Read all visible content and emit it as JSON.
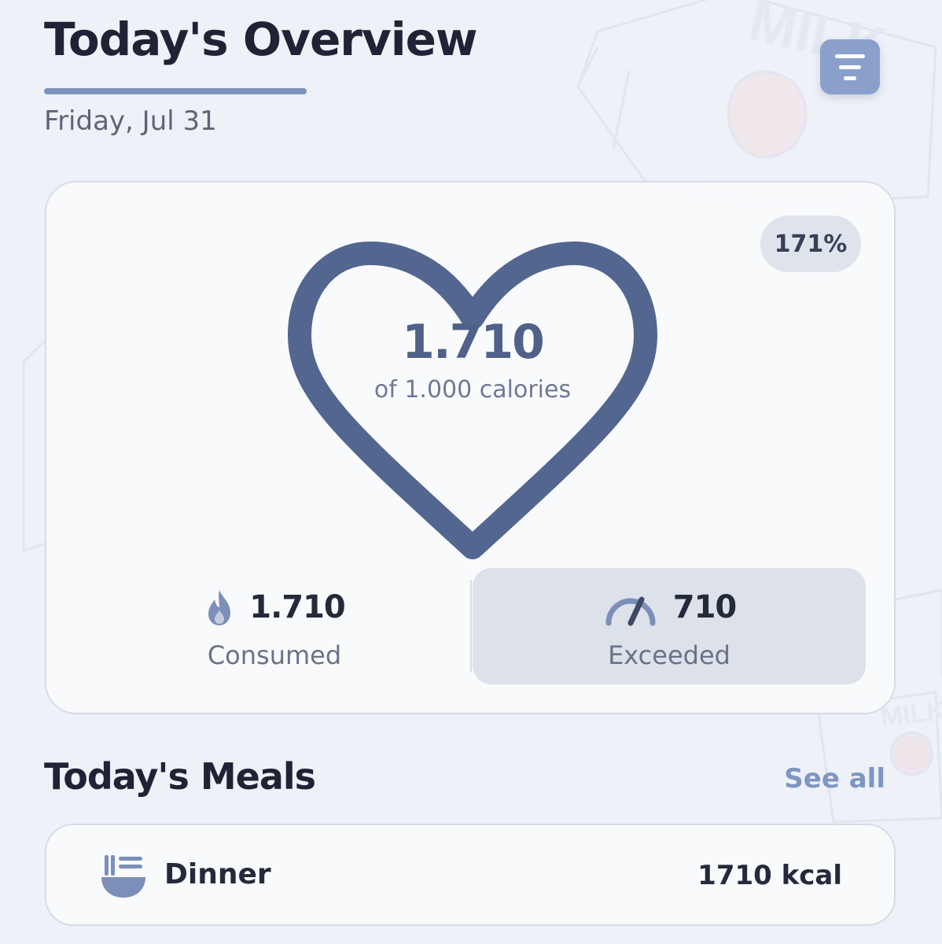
{
  "header": {
    "title": "Today's Overview",
    "date": "Friday, Jul 31"
  },
  "icons": {
    "filter": "filter-icon",
    "consumed": "flame-icon",
    "exceeded": "gauge-icon",
    "meal": "noodle-bowl-icon"
  },
  "colors": {
    "accent": "#7d93bf",
    "heart": "#536690",
    "badge": "#dfe3ec"
  },
  "summary": {
    "percent": "171%",
    "value": "1.710",
    "caption": "of 1.000 calories",
    "consumed_value": "1.710",
    "consumed_label": "Consumed",
    "exceeded_value": "710",
    "exceeded_label": "Exceeded"
  },
  "meals": {
    "title": "Today's Meals",
    "see_all": "See all",
    "items": [
      {
        "name": "Dinner",
        "kcal": "1710 kcal"
      }
    ]
  }
}
